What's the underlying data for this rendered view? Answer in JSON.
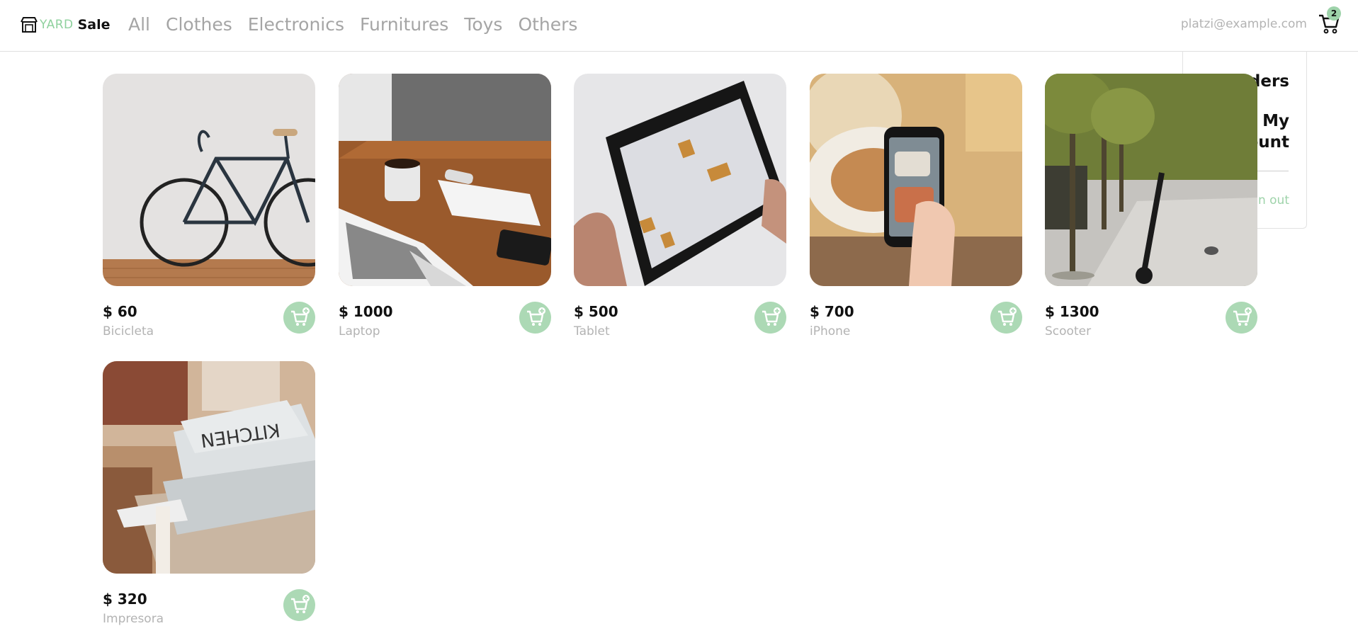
{
  "brand": {
    "part1": "YARD",
    "part2": "Sale"
  },
  "nav": {
    "categories": [
      "All",
      "Clothes",
      "Electronics",
      "Furnitures",
      "Toys",
      "Others"
    ]
  },
  "account": {
    "email": "platzi@example.com",
    "cart_count": "2"
  },
  "menu": {
    "orders": "My orders",
    "account": "My account",
    "signout": "Sign out"
  },
  "products": [
    {
      "price": "$ 60",
      "name": "Bicicleta",
      "image": "bicycle-photo"
    },
    {
      "price": "$ 1000",
      "name": "Laptop",
      "image": "laptop-desk-photo"
    },
    {
      "price": "$ 500",
      "name": "Tablet",
      "image": "tablet-photo"
    },
    {
      "price": "$ 700",
      "name": "iPhone",
      "image": "phone-photo"
    },
    {
      "price": "$ 1300",
      "name": "Scooter",
      "image": "scooter-photo"
    },
    {
      "price": "$ 320",
      "name": "Impresora",
      "image": "printer-photo"
    }
  ],
  "colors": {
    "accent": "#acd9b5",
    "muted_text": "#b3b3b3",
    "nav_text": "#a5a5a5"
  }
}
